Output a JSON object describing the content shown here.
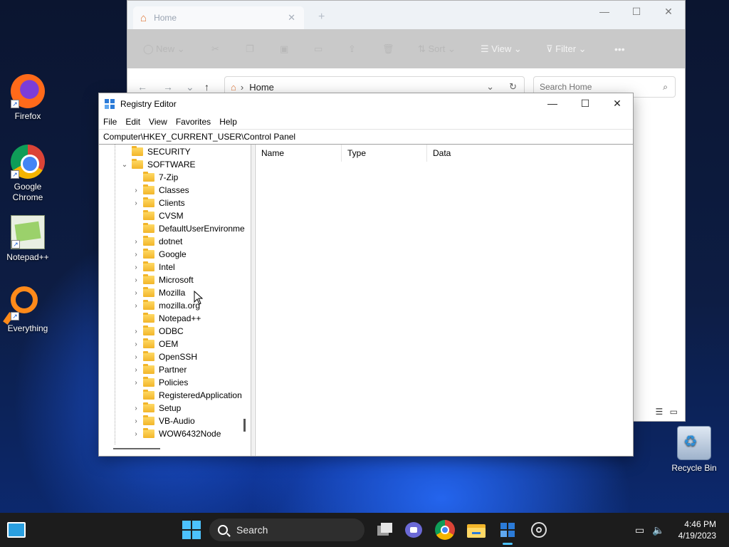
{
  "desktop": {
    "icons": [
      {
        "label": "Firefox"
      },
      {
        "label": "Google Chrome"
      },
      {
        "label": "Notepad++"
      },
      {
        "label": "Everything"
      },
      {
        "label": "Recycle Bin"
      }
    ]
  },
  "explorer": {
    "tab_title": "Home",
    "toolbar": {
      "new": "New",
      "sort": "Sort",
      "view": "View",
      "filter": "Filter",
      "more": "•••"
    },
    "path": "Home",
    "search_placeholder": "Search Home"
  },
  "regedit": {
    "title": "Registry Editor",
    "menu": [
      "File",
      "Edit",
      "View",
      "Favorites",
      "Help"
    ],
    "address": "Computer\\HKEY_CURRENT_USER\\Control Panel",
    "tree": [
      {
        "label": "SECURITY",
        "level": 1,
        "chevron": ""
      },
      {
        "label": "SOFTWARE",
        "level": 1,
        "chevron": "expanded"
      },
      {
        "label": "7-Zip",
        "level": 2,
        "chevron": ""
      },
      {
        "label": "Classes",
        "level": 2,
        "chevron": "collapsed"
      },
      {
        "label": "Clients",
        "level": 2,
        "chevron": "collapsed"
      },
      {
        "label": "CVSM",
        "level": 2,
        "chevron": ""
      },
      {
        "label": "DefaultUserEnvironme",
        "level": 2,
        "chevron": ""
      },
      {
        "label": "dotnet",
        "level": 2,
        "chevron": "collapsed"
      },
      {
        "label": "Google",
        "level": 2,
        "chevron": "collapsed"
      },
      {
        "label": "Intel",
        "level": 2,
        "chevron": "collapsed"
      },
      {
        "label": "Microsoft",
        "level": 2,
        "chevron": "collapsed"
      },
      {
        "label": "Mozilla",
        "level": 2,
        "chevron": "collapsed"
      },
      {
        "label": "mozilla.org",
        "level": 2,
        "chevron": "collapsed"
      },
      {
        "label": "Notepad++",
        "level": 2,
        "chevron": ""
      },
      {
        "label": "ODBC",
        "level": 2,
        "chevron": "collapsed"
      },
      {
        "label": "OEM",
        "level": 2,
        "chevron": "collapsed"
      },
      {
        "label": "OpenSSH",
        "level": 2,
        "chevron": "collapsed"
      },
      {
        "label": "Partner",
        "level": 2,
        "chevron": "collapsed"
      },
      {
        "label": "Policies",
        "level": 2,
        "chevron": "collapsed"
      },
      {
        "label": "RegisteredApplication",
        "level": 2,
        "chevron": ""
      },
      {
        "label": "Setup",
        "level": 2,
        "chevron": "collapsed"
      },
      {
        "label": "VB-Audio",
        "level": 2,
        "chevron": "collapsed"
      },
      {
        "label": "WOW6432Node",
        "level": 2,
        "chevron": "collapsed"
      }
    ],
    "columns": [
      "Name",
      "Type",
      "Data"
    ]
  },
  "taskbar": {
    "search_label": "Search",
    "time": "4:46 PM",
    "date": "4/19/2023",
    "accent": "#4cc2ff"
  }
}
